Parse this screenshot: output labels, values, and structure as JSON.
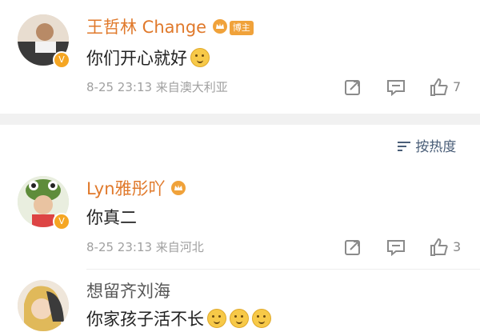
{
  "comments": [
    {
      "username": "王哲林 Change",
      "badge_text": "博主",
      "text": "你们开心就好",
      "meta": "8-25 23:13  来自澳大利亚",
      "likes": "7"
    },
    {
      "username": "Lyn雅彤吖",
      "text": "你真二",
      "meta": "8-25 23:13  来自河北",
      "likes": "3"
    },
    {
      "username": "想留齐刘海",
      "text": "你家孩子活不长"
    }
  ],
  "sort_label": "按热度",
  "colors": {
    "username": "#e0792b",
    "meta": "#a0a0a0",
    "badge": "#f5a623"
  },
  "icons": [
    "repost-icon",
    "comment-icon",
    "like-icon",
    "sort-icon",
    "verified-badge-icon",
    "crown-icon"
  ]
}
